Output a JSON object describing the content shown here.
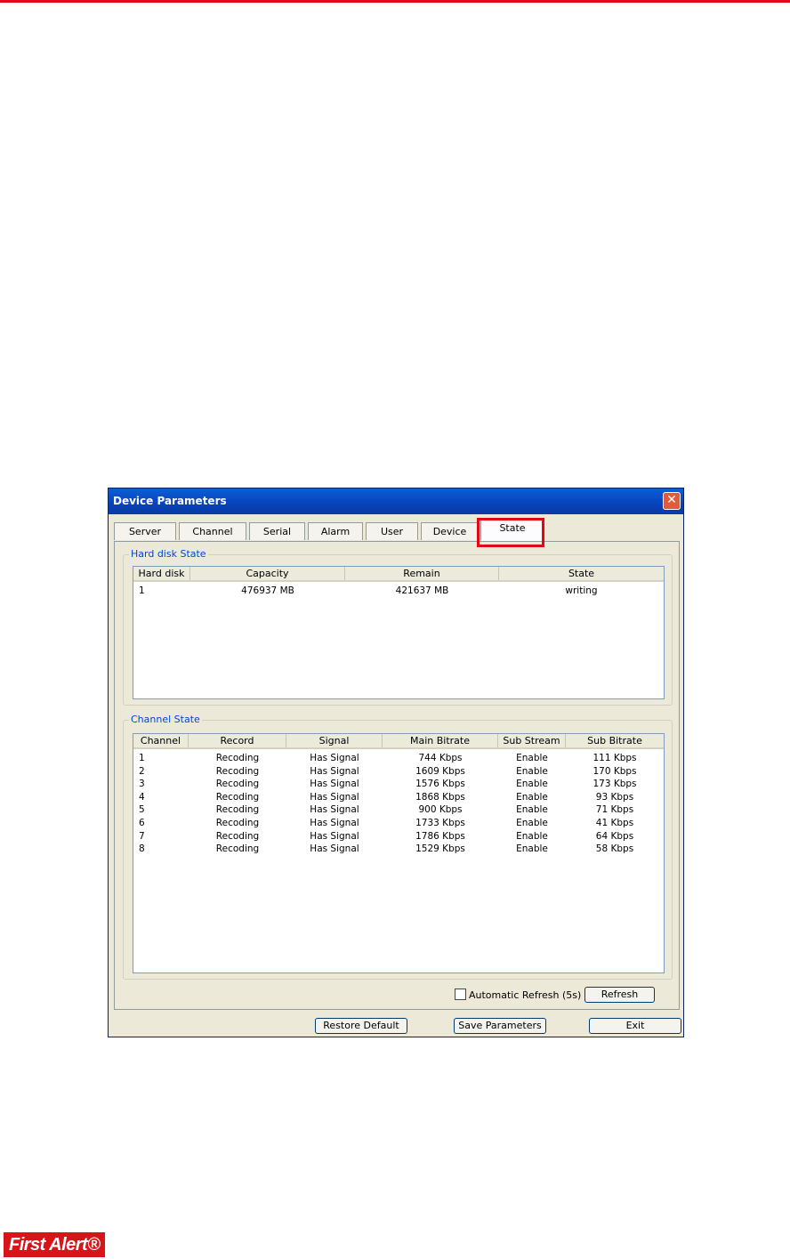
{
  "dialog": {
    "title": "Device Parameters",
    "close_glyph": "✕"
  },
  "tabs": [
    {
      "label": "Server"
    },
    {
      "label": "Channel"
    },
    {
      "label": "Serial"
    },
    {
      "label": "Alarm"
    },
    {
      "label": "User"
    },
    {
      "label": "Device"
    },
    {
      "label": "State",
      "active": true
    }
  ],
  "hard_disk_state": {
    "group_label": "Hard disk State",
    "columns": [
      "Hard disk",
      "Capacity",
      "Remain",
      "State"
    ],
    "rows": [
      [
        "1",
        "476937 MB",
        "421637 MB",
        "writing"
      ]
    ]
  },
  "channel_state": {
    "group_label": "Channel State",
    "columns": [
      "Channel",
      "Record",
      "Signal",
      "Main Bitrate",
      "Sub Stream",
      "Sub Bitrate"
    ],
    "rows": [
      [
        "1",
        "Recoding",
        "Has Signal",
        "744 Kbps",
        "Enable",
        "111 Kbps"
      ],
      [
        "2",
        "Recoding",
        "Has Signal",
        "1609 Kbps",
        "Enable",
        "170 Kbps"
      ],
      [
        "3",
        "Recoding",
        "Has Signal",
        "1576 Kbps",
        "Enable",
        "173 Kbps"
      ],
      [
        "4",
        "Recoding",
        "Has Signal",
        "1868 Kbps",
        "Enable",
        "93 Kbps"
      ],
      [
        "5",
        "Recoding",
        "Has Signal",
        "900 Kbps",
        "Enable",
        "71 Kbps"
      ],
      [
        "6",
        "Recoding",
        "Has Signal",
        "1733 Kbps",
        "Enable",
        "41 Kbps"
      ],
      [
        "7",
        "Recoding",
        "Has Signal",
        "1786 Kbps",
        "Enable",
        "64 Kbps"
      ],
      [
        "8",
        "Recoding",
        "Has Signal",
        "1529 Kbps",
        "Enable",
        "58 Kbps"
      ]
    ]
  },
  "auto_refresh": {
    "label": "Automatic Refresh (5s)",
    "checked": false
  },
  "buttons": {
    "refresh": "Refresh",
    "restore_default": "Restore Default",
    "save_parameters": "Save Parameters",
    "exit": "Exit"
  },
  "footer": {
    "logo_text": "First Alert®"
  },
  "colors": {
    "accent_red": "#e30613",
    "title_blue": "#0842b8",
    "group_title_blue": "#0046d5"
  }
}
